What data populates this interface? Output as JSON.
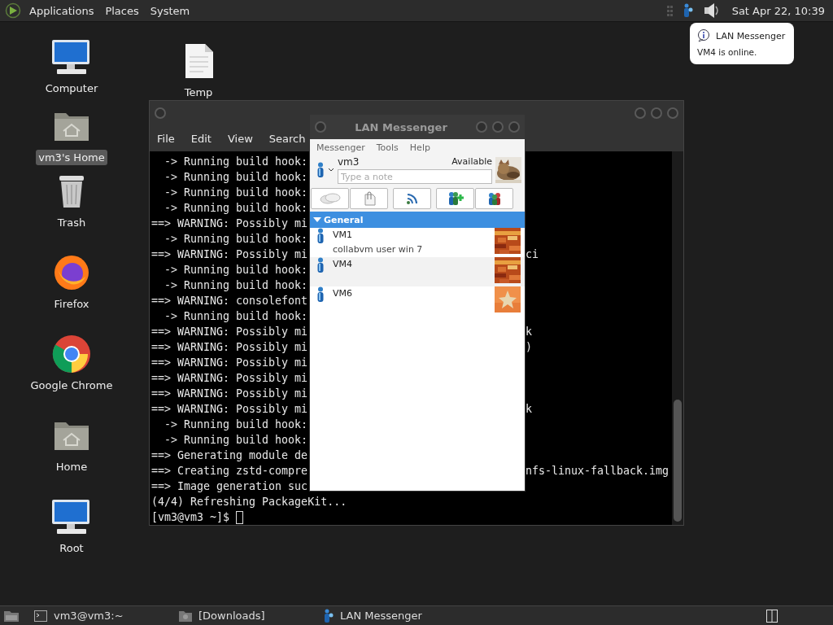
{
  "top_panel": {
    "menus": [
      "Applications",
      "Places",
      "System"
    ],
    "clock": "Sat Apr 22, 10:39"
  },
  "notification": {
    "title": "LAN Messenger",
    "message": "VM4 is online."
  },
  "desktop_icons": [
    {
      "label": "Computer",
      "kind": "computer",
      "selected": false
    },
    {
      "label": "Temp",
      "kind": "document",
      "selected": false
    },
    {
      "label": "vm3's Home",
      "kind": "home",
      "selected": true
    },
    {
      "label": "Trash",
      "kind": "trash",
      "selected": false
    },
    {
      "label": "Firefox",
      "kind": "firefox",
      "selected": false
    },
    {
      "label": "Google Chrome",
      "kind": "chrome",
      "selected": false
    },
    {
      "label": "Home",
      "kind": "home",
      "selected": false
    },
    {
      "label": "Root",
      "kind": "computer",
      "selected": false
    }
  ],
  "terminal": {
    "menus": [
      "File",
      "Edit",
      "View",
      "Search"
    ],
    "lines": [
      {
        "left": "  -> Running build hook:"
      },
      {
        "left": "  -> Running build hook:"
      },
      {
        "left": "  -> Running build hook:"
      },
      {
        "left": "  -> Running build hook:"
      },
      {
        "left": "==> WARNING: Possibly mi"
      },
      {
        "left": "  -> Running build hook:"
      },
      {
        "left": "==> WARNING: Possibly mi",
        "right": "ci"
      },
      {
        "left": "  -> Running build hook:"
      },
      {
        "left": "  -> Running build hook:"
      },
      {
        "left": "==> WARNING: consolefont"
      },
      {
        "left": "  -> Running build hook:"
      },
      {
        "left": "==> WARNING: Possibly mi",
        "right": "k"
      },
      {
        "left": "==> WARNING: Possibly mi",
        "right": ")"
      },
      {
        "left": "==> WARNING: Possibly mi"
      },
      {
        "left": "==> WARNING: Possibly mi"
      },
      {
        "left": "==> WARNING: Possibly mi"
      },
      {
        "left": "==> WARNING: Possibly mi",
        "right": "k"
      },
      {
        "left": "  -> Running build hook:"
      },
      {
        "left": "  -> Running build hook:"
      },
      {
        "left": "==> Generating module de"
      },
      {
        "left": "==> Creating zstd-compre",
        "right": "nfs-linux-fallback.img"
      },
      {
        "left": "==> Image generation suc"
      },
      {
        "left": "(4/4) Refreshing PackageKit..."
      }
    ],
    "prompt": "[vm3@vm3 ~]$"
  },
  "messenger": {
    "title": "LAN Messenger",
    "menus": [
      "Messenger",
      "Tools",
      "Help"
    ],
    "user": {
      "name": "vm3",
      "status": "Available",
      "note_placeholder": "Type a note"
    },
    "group": {
      "name": "General",
      "expanded": true,
      "contacts": [
        {
          "name": "VM1",
          "note": "collabvm user win 7"
        },
        {
          "name": "VM4"
        },
        {
          "name": "VM6"
        }
      ]
    }
  },
  "taskbar": {
    "items": [
      {
        "label": "vm3@vm3:~",
        "kind": "terminal"
      },
      {
        "label": "[Downloads]",
        "kind": "folder"
      },
      {
        "label": "LAN Messenger",
        "kind": "messenger"
      }
    ]
  }
}
